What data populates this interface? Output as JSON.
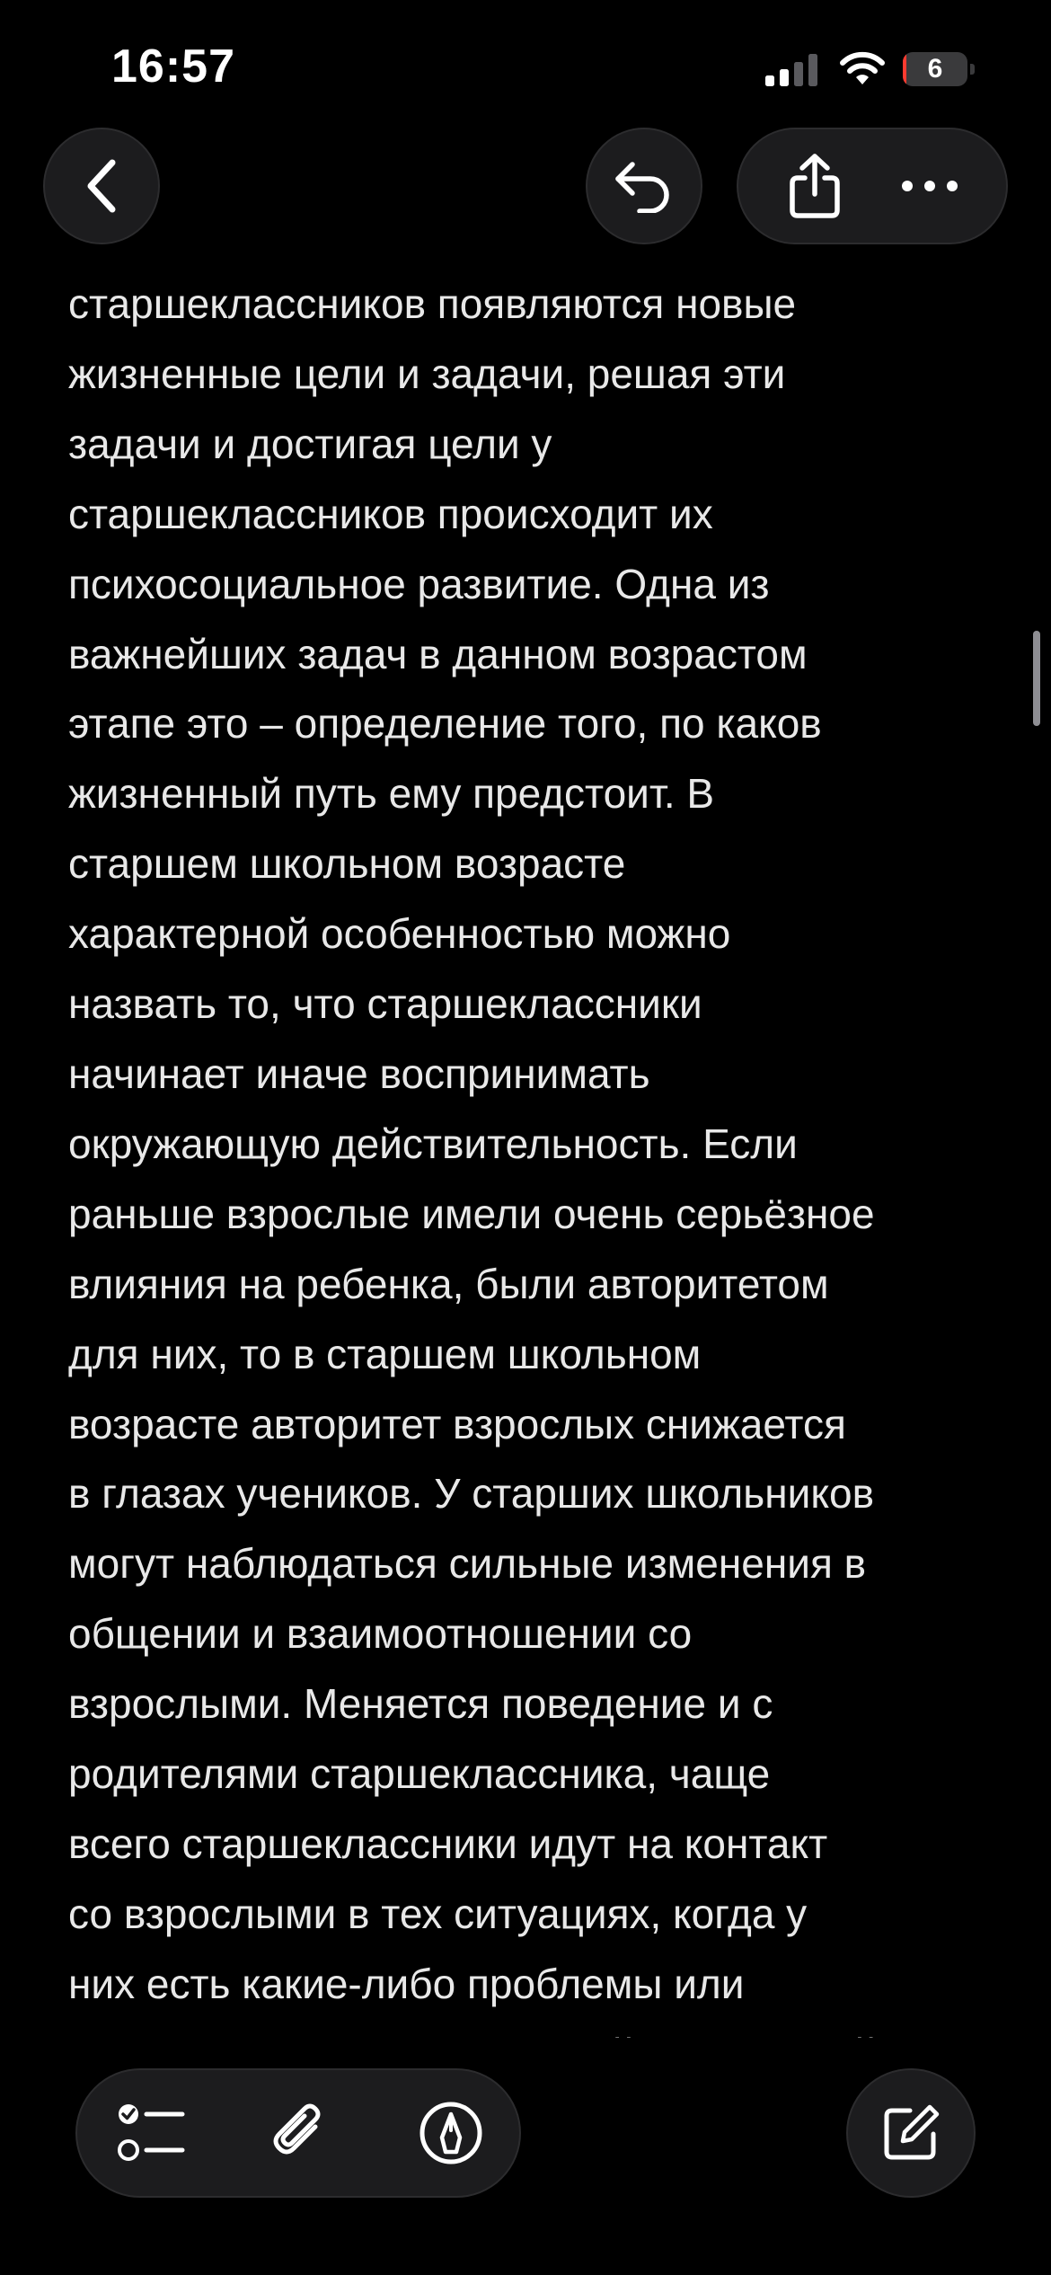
{
  "status_bar": {
    "time": "16:57",
    "battery_level": "6",
    "battery_percent": 6,
    "icons": [
      "cellular-signal-icon",
      "wifi-icon",
      "battery-icon"
    ]
  },
  "nav": {
    "icons": [
      "chevron-left-icon",
      "undo-icon",
      "share-icon",
      "more-icon"
    ]
  },
  "note": {
    "lines": [
      "старшеклассников появляются новые",
      "жизненные цели и задачи, решая эти",
      "задачи и достигая цели у",
      "старшеклассников происходит их",
      "психосоциальное развитие. Одна из",
      "важнейших задач в данном возрастом",
      "этапе это – определение того, по каков",
      "жизненный путь ему предстоит. В",
      "старшем школьном возрасте",
      "характерной особенностью можно",
      "назвать то, что старшеклассники",
      "начинает иначе воспринимать",
      "окружающую действительность. Если",
      "раньше взрослые имели очень серьёзное",
      "влияния на ребенка, были авторитетом",
      "для них, то в старшем школьном",
      "возрасте авторитет взрослых снижается",
      "в глазах учеников. У старших школьников",
      "могут наблюдаться сильные изменения в",
      "общении и взаимоотношении со",
      "взрослыми. Меняется поведение и с",
      "родителями старшеклассника, чаще",
      "всего старшеклассники идут на контакт",
      "со взрослыми в тех ситуациях, когда у",
      "них есть какие-либо проблемы или",
      "трудности в жизни. Основной поддержкой"
    ]
  },
  "toolbar": {
    "icons": [
      "checklist-icon",
      "paperclip-icon",
      "markup-pen-icon",
      "compose-icon"
    ]
  },
  "colors": {
    "background": "#000000",
    "text": "#e8e8e8",
    "button_bg": "#1c1c1e",
    "battery_low": "#ff3b30"
  }
}
